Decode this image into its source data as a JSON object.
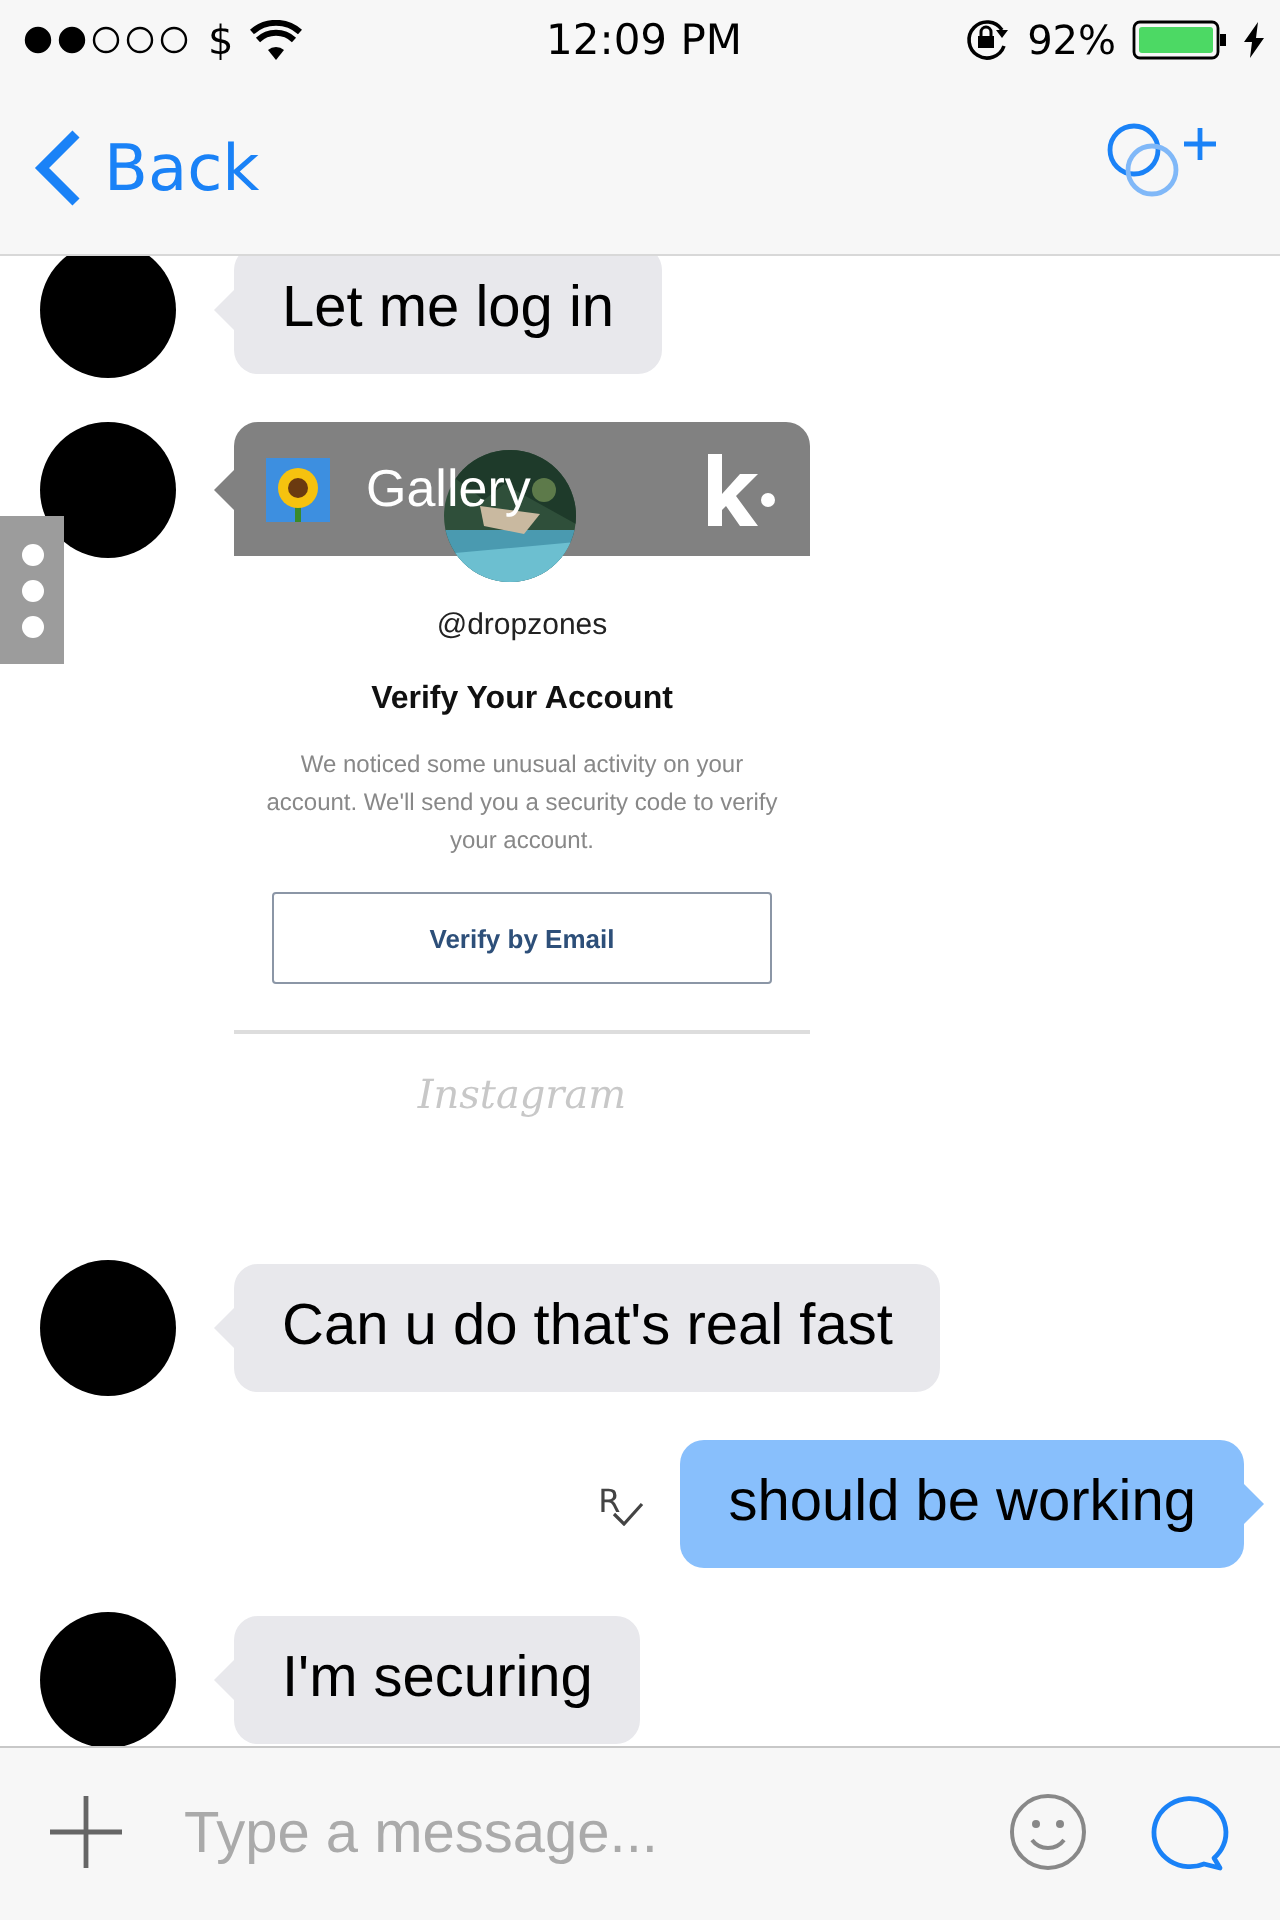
{
  "status_bar": {
    "carrier": "$",
    "time": "12:09 PM",
    "battery": "92%"
  },
  "nav": {
    "back": "Back"
  },
  "messages": [
    {
      "kind": "incoming",
      "text": "Let me log in"
    },
    {
      "app": "Gallery",
      "handle": "@dropzones",
      "title": "Verify Your Account",
      "body": "We noticed some unusual activity on your account. We'll send you a security code to verify your account.",
      "button": "Verify by Email",
      "footer": "Instagram"
    },
    {
      "kind": "incoming",
      "text": "Can u do that's real fast"
    },
    {
      "kind": "outgoing",
      "text": "should be working",
      "receipt": "R"
    },
    {
      "kind": "incoming",
      "text": "I'm securing"
    }
  ],
  "composer": {
    "placeholder": "Type a message..."
  }
}
